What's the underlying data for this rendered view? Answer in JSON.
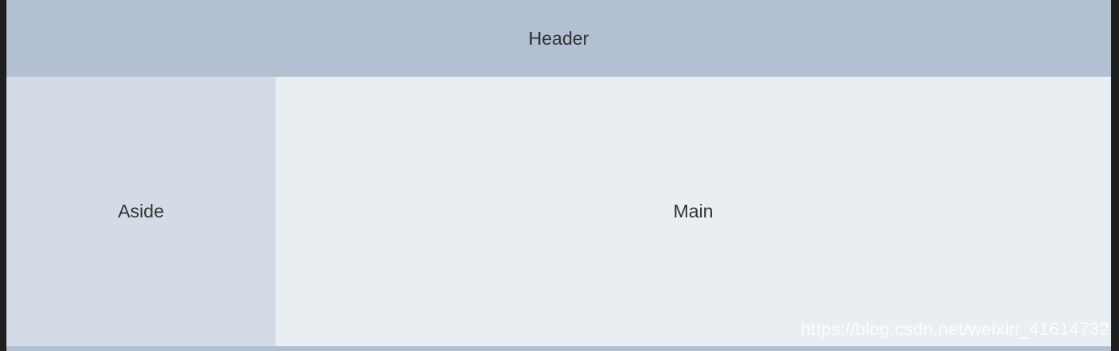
{
  "header": {
    "label": "Header"
  },
  "aside": {
    "label": "Aside"
  },
  "main": {
    "label": "Main"
  },
  "watermark": {
    "text": "https://blog.csdn.net/weixin_41614732"
  },
  "colors": {
    "header_bg": "#b3c0d1",
    "aside_bg": "#d3dce6",
    "main_bg": "#e9eef3",
    "text": "#333333"
  }
}
